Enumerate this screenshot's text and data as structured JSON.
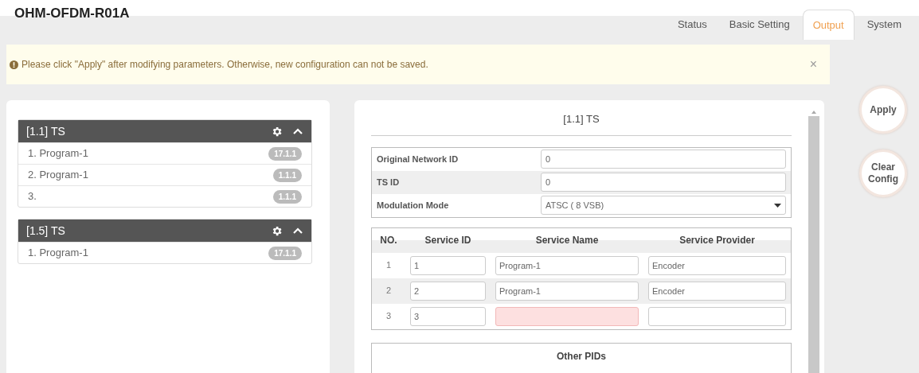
{
  "title": "OHM-OFDM-R01A",
  "tabs": [
    {
      "label": "Status",
      "selected": false
    },
    {
      "label": "Basic Setting",
      "selected": false
    },
    {
      "label": "Output",
      "selected": true
    },
    {
      "label": "System",
      "selected": false
    }
  ],
  "alert": {
    "message": "Please click \"Apply\" after modifying parameters. Otherwise, new configuration can not be saved.",
    "close": "×"
  },
  "ts_groups": [
    {
      "title": "[1.1] TS",
      "expanded": true,
      "programs": [
        {
          "label": "1. Program-1",
          "badge": "17.1.1"
        },
        {
          "label": "2. Program-1",
          "badge": "1.1.1"
        },
        {
          "label": "3.",
          "badge": "1.1.1"
        }
      ]
    },
    {
      "title": "[1.5] TS",
      "expanded": true,
      "programs": [
        {
          "label": "1. Program-1",
          "badge": "17.1.1"
        }
      ]
    }
  ],
  "detail": {
    "title": "[1.1] TS",
    "fields": [
      {
        "label": "Original Network ID",
        "kind": "input",
        "value": "0"
      },
      {
        "label": "TS ID",
        "kind": "input",
        "value": "0"
      },
      {
        "label": "Modulation Mode",
        "kind": "select",
        "value": "ATSC ( 8 VSB)"
      }
    ],
    "services": {
      "columns": [
        "NO.",
        "Service ID",
        "Service Name",
        "Service Provider"
      ],
      "rows": [
        {
          "no": "1",
          "service_id": "1",
          "service_name": "Program-1",
          "service_provider": "Encoder",
          "invalid": false
        },
        {
          "no": "2",
          "service_id": "2",
          "service_name": "Program-1",
          "service_provider": "Encoder",
          "invalid": false
        },
        {
          "no": "3",
          "service_id": "3",
          "service_name": "",
          "service_provider": "",
          "invalid": true
        }
      ]
    },
    "other_pids_title": "Other PIDs"
  },
  "actions": [
    "Apply",
    "Clear Config"
  ]
}
